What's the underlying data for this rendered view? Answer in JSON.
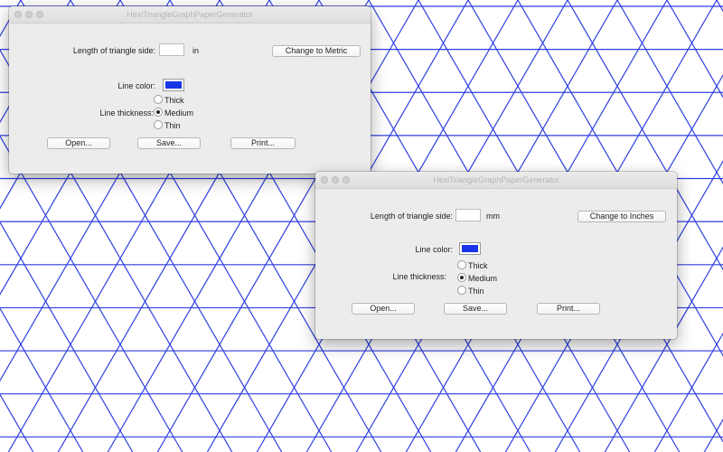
{
  "theme": {
    "grid_color": "#2f3fe0",
    "swatch_color": "#1a35e8"
  },
  "windows": [
    {
      "title": "HexiTriangleGraphPaperGenerator",
      "length_label": "Length of triangle side:",
      "length_value": "",
      "unit": "in",
      "change_units_button": "Change to Metric",
      "line_color_label": "Line color:",
      "thickness_label": "Line thickness:",
      "options": [
        "Thick",
        "Medium",
        "Thin"
      ],
      "selected": "Medium",
      "open_button": "Open...",
      "save_button": "Save...",
      "print_button": "Print..."
    },
    {
      "title": "HexiTriangleGraphPaperGenerator",
      "length_label": "Length of triangle side:",
      "length_value": "",
      "unit": "mm",
      "change_units_button": "Change to Inches",
      "line_color_label": "Line color:",
      "thickness_label": "Line thickness:",
      "options": [
        "Thick",
        "Medium",
        "Thin"
      ],
      "selected": "Medium",
      "open_button": "Open...",
      "save_button": "Save...",
      "print_button": "Print..."
    }
  ]
}
